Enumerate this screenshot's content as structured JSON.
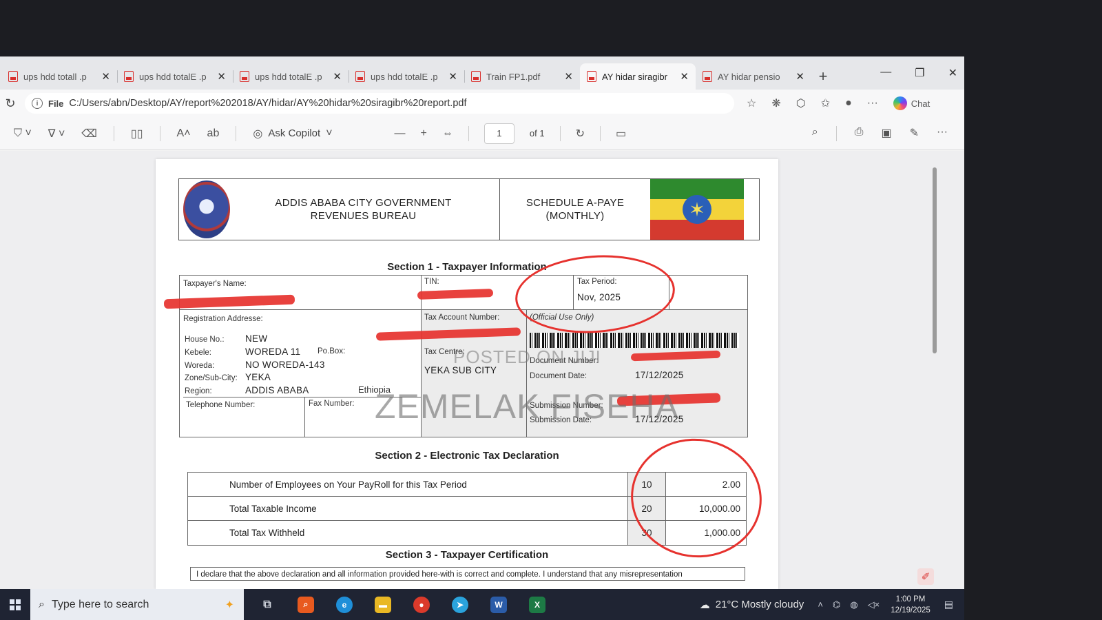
{
  "browser": {
    "tabs": [
      {
        "title": "ups hdd totall .p",
        "active": false
      },
      {
        "title": "ups hdd totalE .p",
        "active": false
      },
      {
        "title": "ups hdd totalE .p",
        "active": false
      },
      {
        "title": "ups hdd totalE .p",
        "active": false
      },
      {
        "title": "Train FP1.pdf",
        "active": false
      },
      {
        "title": "AY hidar siragibr",
        "active": true
      },
      {
        "title": "AY hidar pensio",
        "active": false
      }
    ],
    "address": {
      "file_label": "File",
      "url": "C:/Users/abn/Desktop/AY/report%202018/AY/hidar/AY%20hidar%20siragibr%20report.pdf"
    },
    "chat_label": "Chat"
  },
  "pdf_toolbar": {
    "ask_copilot": "Ask Copilot",
    "page_current": "1",
    "page_total": "of 1"
  },
  "document": {
    "header": {
      "org_line1": "ADDIS ABABA CITY GOVERNMENT",
      "org_line2": "REVENUES BUREAU",
      "schedule_line1": "SCHEDULE A-PAYE",
      "schedule_line2": "(MONTHLY)"
    },
    "section1": {
      "title": "Section 1 - Taxpayer Information",
      "taxpayer_name_label": "Taxpayer's Name:",
      "tin_label": "TIN:",
      "tax_period_label": "Tax Period:",
      "tax_period_value": "Nov, 2025",
      "registration_address_label": "Registration Addresse:",
      "tax_account_label": "Tax Account Number:",
      "official_use": "(Official Use Only)",
      "house_no_label": "House No.:",
      "house_no_value": "NEW",
      "kebele_label": "Kebele:",
      "kebele_value": "WOREDA 11",
      "pobox_label": "Po.Box:",
      "woreda_label": "Woreda:",
      "woreda_value": "NO WOREDA-143",
      "zone_label": "Zone/Sub-City:",
      "zone_value": "YEKA",
      "region_label": "Region:",
      "region_value": "ADDIS ABABA",
      "country_value": "Ethiopia",
      "tax_centre_label": "Tax Centre:",
      "tax_centre_value": "YEKA SUB CITY",
      "document_number_label": "Document Number:",
      "document_date_label": "Document Date:",
      "document_date_value": "17/12/2025",
      "telephone_label": "Telephone Number:",
      "fax_label": "Fax Number:",
      "submission_number_label": "Submission Number:",
      "submission_date_label": "Submission Date:",
      "submission_date_value": "17/12/2025"
    },
    "section2": {
      "title": "Section 2 - Electronic Tax Declaration",
      "rows": [
        {
          "desc": "Number of Employees on Your PayRoll for this Tax Period",
          "code": "10",
          "amount": "2.00"
        },
        {
          "desc": "Total Taxable Income",
          "code": "20",
          "amount": "10,000.00"
        },
        {
          "desc": "Total Tax Withheld",
          "code": "30",
          "amount": "1,000.00"
        }
      ]
    },
    "section3": {
      "title": "Section 3 - Taxpayer Certification",
      "text": "I declare that the above declaration and all information provided here-with is correct and complete. I understand that any misrepresentation"
    },
    "watermark_small": "POSTED ON JIJI",
    "watermark_big": "ZEMELAK FISEHA"
  },
  "taskbar": {
    "search_placeholder": "Type here to search",
    "weather": "21°C  Mostly cloudy",
    "time": "1:00 PM",
    "date": "12/19/2025"
  },
  "colors": {
    "annotation_red": "#e6322e",
    "flag_green": "#2e8a2e",
    "flag_yellow": "#f3d33a",
    "flag_red": "#d43a2f"
  }
}
